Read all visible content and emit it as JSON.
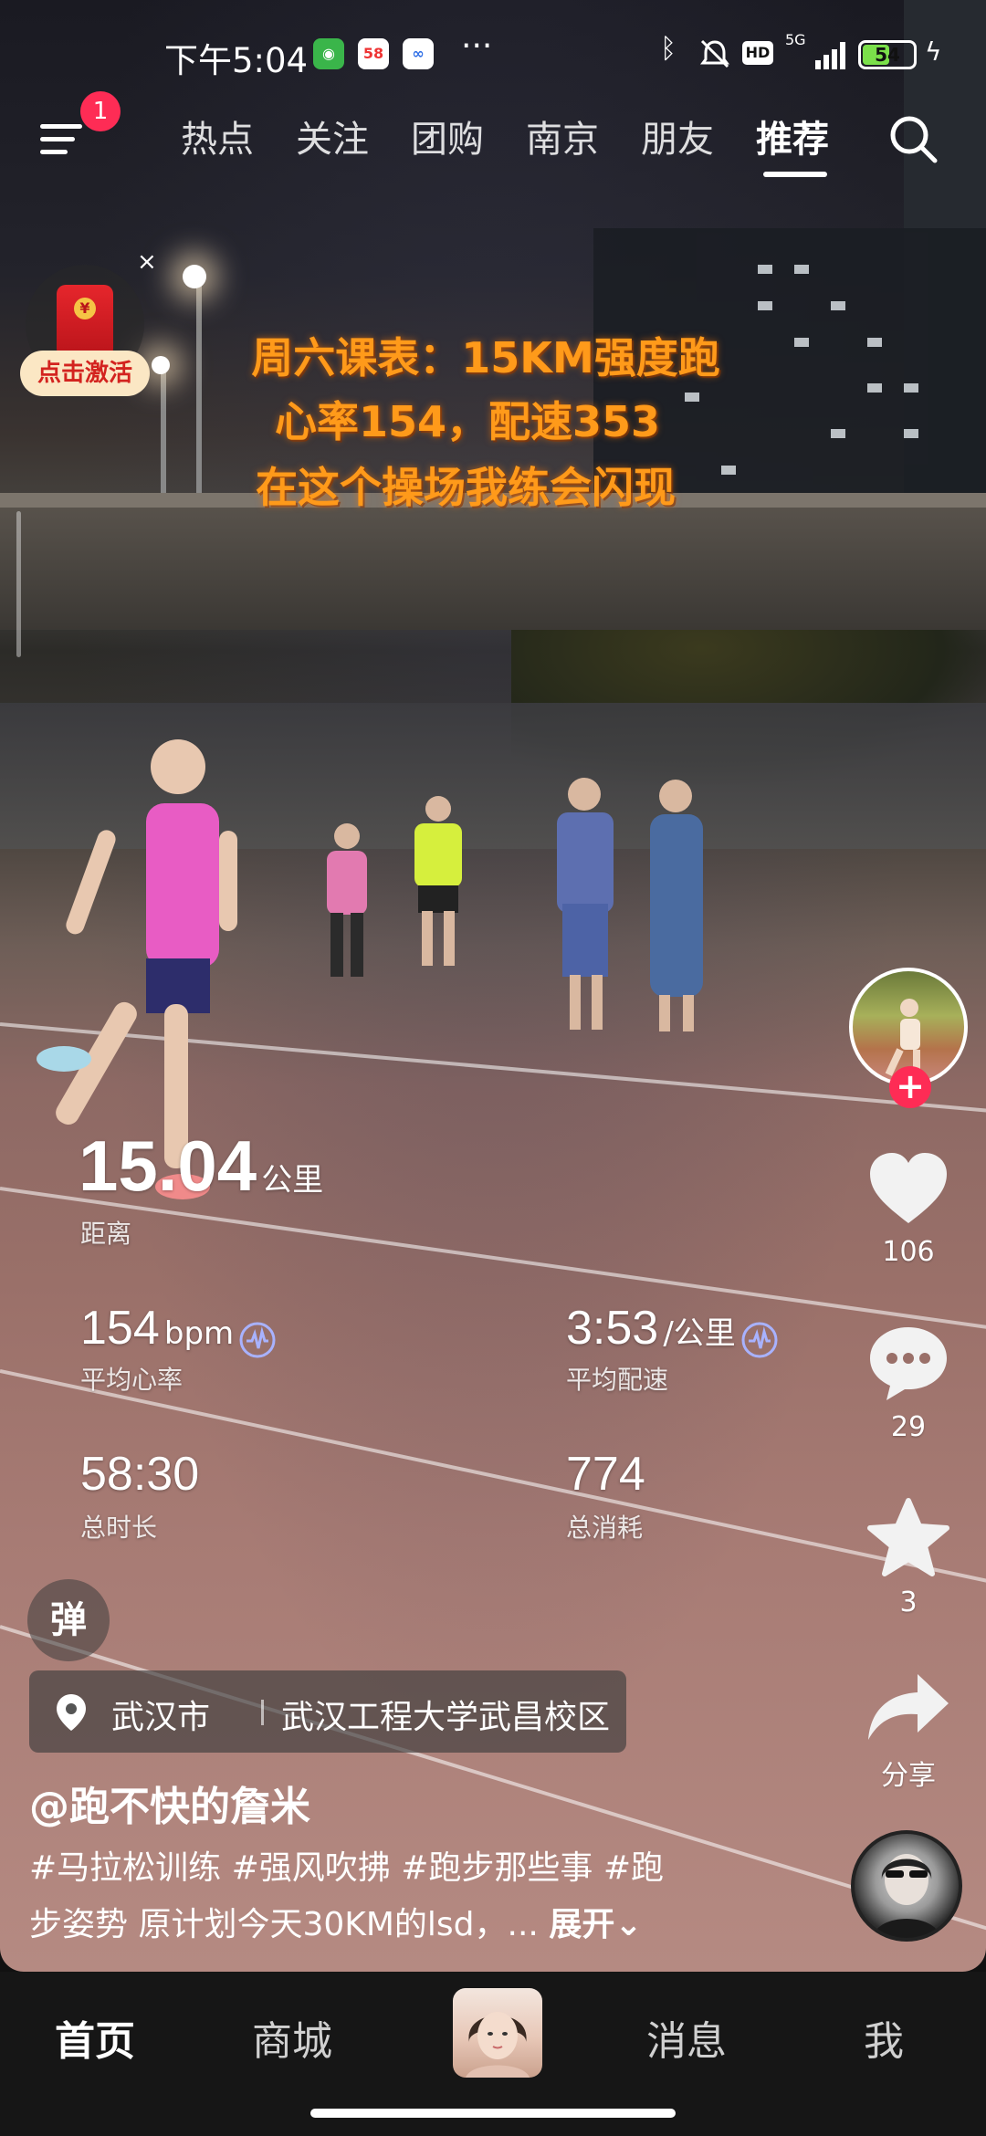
{
  "status_bar": {
    "time": "下午5:04",
    "app_badges": [
      "wechat-icon",
      "58-app-icon",
      "baidu-icon"
    ],
    "more": "···",
    "hd": "HD",
    "network": "5G",
    "battery": "54",
    "battery_level": 0.54
  },
  "top_nav": {
    "menu_badge": "1",
    "tabs": [
      {
        "label": "热点",
        "active": false
      },
      {
        "label": "关注",
        "active": false
      },
      {
        "label": "团购",
        "active": false
      },
      {
        "label": "南京",
        "active": false
      },
      {
        "label": "朋友",
        "active": false
      },
      {
        "label": "推荐",
        "active": true
      }
    ],
    "search_icon": "search-icon"
  },
  "red_packet": {
    "label": "点击激活",
    "close": "×"
  },
  "video_caption": {
    "line1": "周六课表：15KM强度跑",
    "line2": "心率154，配速353",
    "line3": "在这个操场我练会闪现"
  },
  "run_stats": {
    "distance_value": "15.04",
    "distance_unit": "公里",
    "distance_label": "距离",
    "hr_value": "154",
    "hr_unit": "bpm",
    "hr_label": "平均心率",
    "pace_value": "3:53",
    "pace_unit": "/公里",
    "pace_label": "平均配速",
    "duration_value": "58:30",
    "duration_label": "总时长",
    "calories_value": "774",
    "calories_label": "总消耗"
  },
  "actions": {
    "follow": "+",
    "likes": "106",
    "comments": "29",
    "favorites": "3",
    "share_label": "分享"
  },
  "danmu_label": "弹",
  "location": {
    "city": "武汉市",
    "place": "武汉工程大学武昌校区"
  },
  "post": {
    "author": "@跑不快的詹米",
    "desc_line1": "#马拉松训练 #强风吹拂 #跑步那些事 #跑",
    "desc_line2": "步姿势 原计划今天30KM的lsd，...",
    "expand": "展开"
  },
  "bottom_nav": {
    "items": [
      {
        "label": "首页",
        "active": true
      },
      {
        "label": "商城",
        "active": false
      },
      {
        "label": "消息",
        "active": false
      },
      {
        "label": "我",
        "active": false
      }
    ]
  }
}
